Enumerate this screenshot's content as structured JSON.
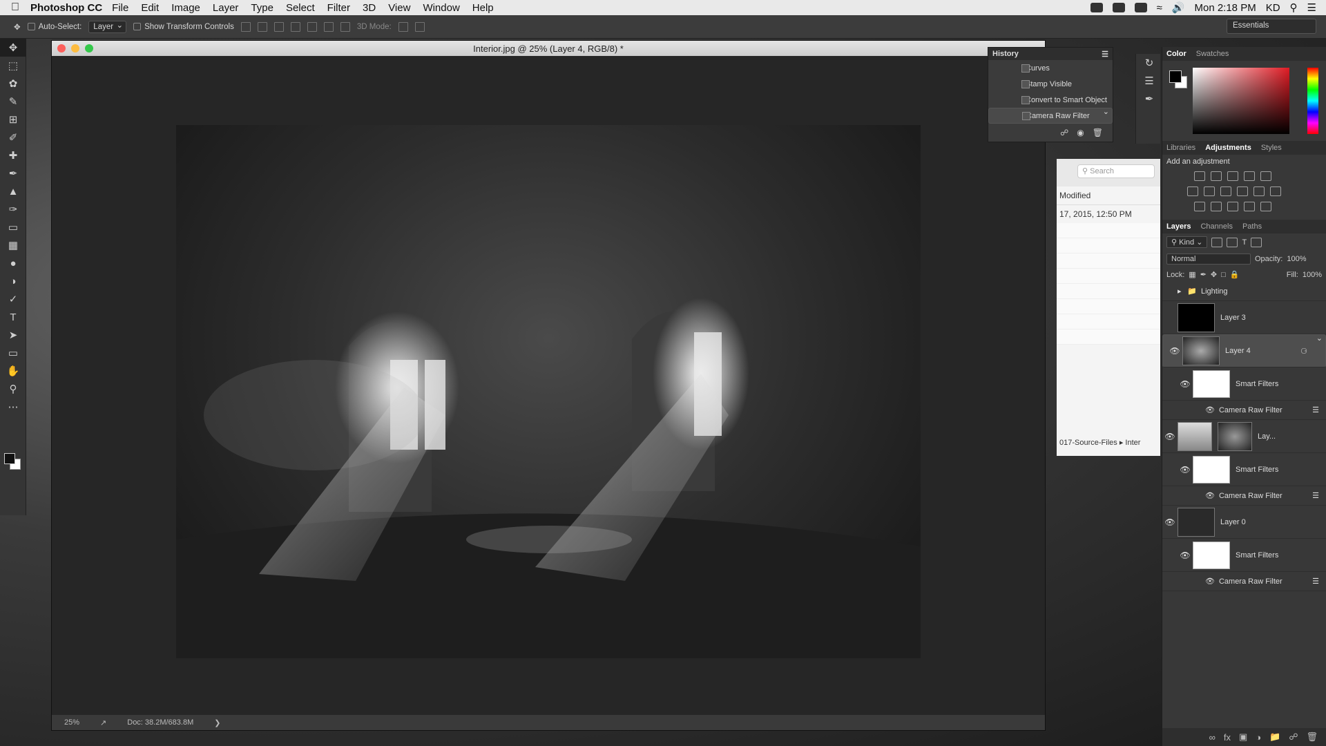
{
  "menubar": {
    "app": "Photoshop CC",
    "items": [
      "File",
      "Edit",
      "Image",
      "Layer",
      "Type",
      "Select",
      "Filter",
      "3D",
      "View",
      "Window",
      "Help"
    ],
    "clock": "Mon 2:18 PM",
    "user": "KD"
  },
  "options": {
    "auto_select": "Auto-Select:",
    "auto_select_value": "Layer",
    "transform": "Show Transform Controls",
    "mode3d": "3D Mode:",
    "workspace": "Essentials"
  },
  "document": {
    "title": "Interior.jpg @ 25% (Layer 4, RGB/8) *",
    "zoom": "25%",
    "docsize": "Doc: 38.2M/683.8M"
  },
  "history": {
    "title": "History",
    "items": [
      "Curves",
      "Stamp Visible",
      "Convert to Smart Object",
      "Camera Raw Filter"
    ]
  },
  "finder": {
    "search": "Search",
    "col": "Modified",
    "date": "17, 2015, 12:50 PM",
    "path1": "017-Source-Files",
    "path2": "Inter"
  },
  "color_panel": {
    "tabs": [
      "Color",
      "Swatches"
    ]
  },
  "adjust_panel": {
    "tabs": [
      "Libraries",
      "Adjustments",
      "Styles"
    ],
    "hint": "Add an adjustment"
  },
  "layers_panel": {
    "tabs": [
      "Layers",
      "Channels",
      "Paths"
    ],
    "kind": "Kind",
    "blend": "Normal",
    "opacity_label": "Opacity:",
    "opacity": "100%",
    "lock_label": "Lock:",
    "fill_label": "Fill:",
    "fill": "100%",
    "group": "Lighting",
    "layers": [
      "Layer 3",
      "Layer 4",
      "Lay...",
      "Layer 0"
    ],
    "smart": "Smart Filters",
    "camraw": "Camera Raw Filter"
  }
}
